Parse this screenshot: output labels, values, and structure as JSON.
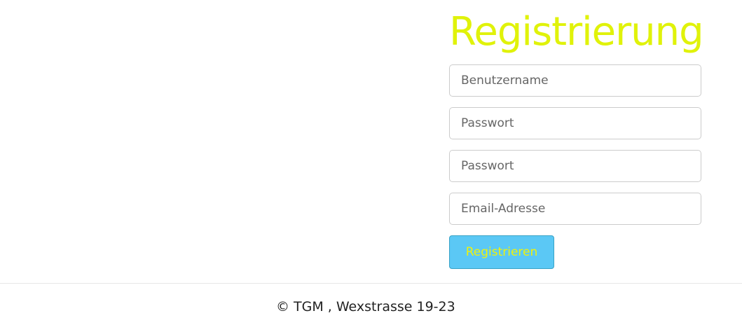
{
  "form": {
    "title": "Registrierung",
    "username_placeholder": "Benutzername",
    "password_placeholder": "Passwort",
    "password_confirm_placeholder": "Passwort",
    "email_placeholder": "Email-Adresse",
    "submit_label": "Registrieren"
  },
  "footer": {
    "text": "© TGM , Wexstrasse 19-23"
  },
  "colors": {
    "title": "#e0f20a",
    "button_background": "#5bc8f5",
    "button_text": "#f0f20a"
  }
}
